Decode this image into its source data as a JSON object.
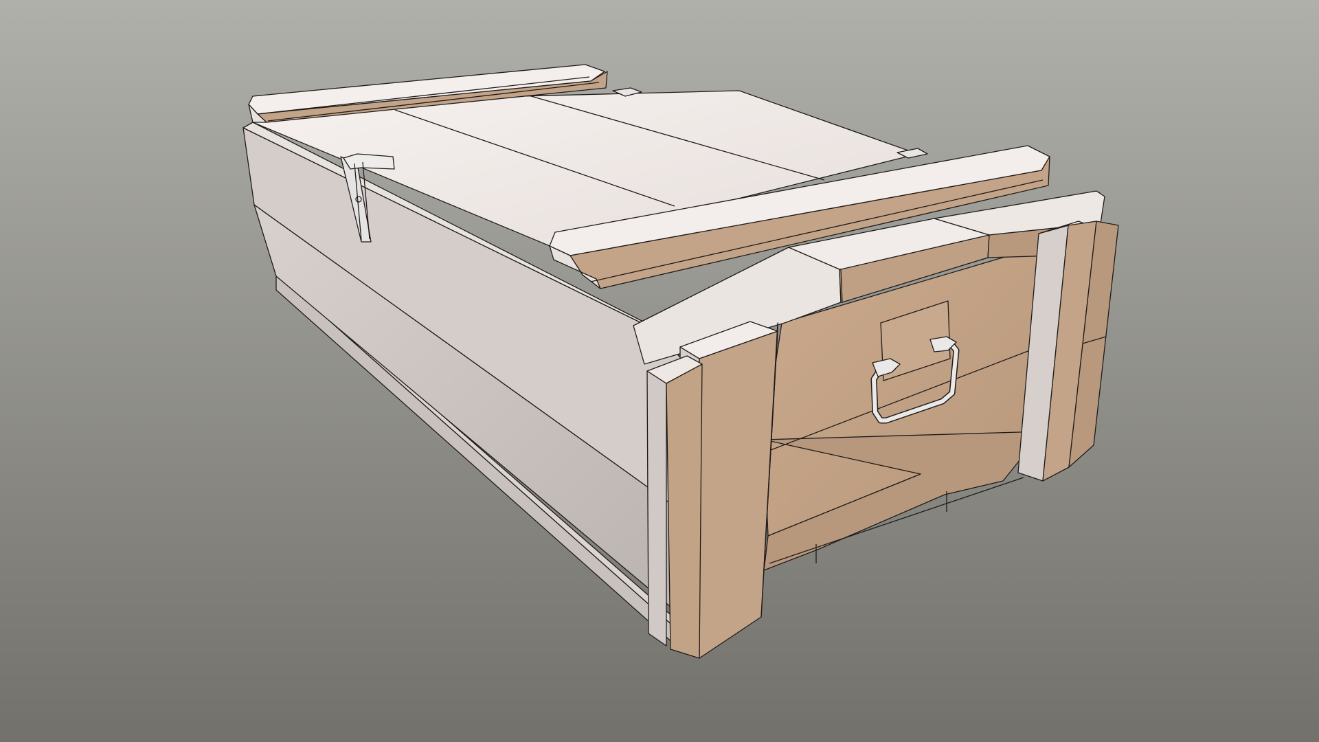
{
  "scene": {
    "subject": "wooden-crate-3d-wireframe-render",
    "colors": {
      "background_top": "#b0b0ab",
      "background_bottom": "#72716b",
      "wood_light": "#ece6e3",
      "wood_light_side": "#c9c1bd",
      "wood_shadow": "#aaa3a0",
      "wood_tan": "#c4a488",
      "wood_tan_dark": "#b3957a",
      "edge_line": "#1e1b1a",
      "metal": "#e6e4e2"
    }
  }
}
